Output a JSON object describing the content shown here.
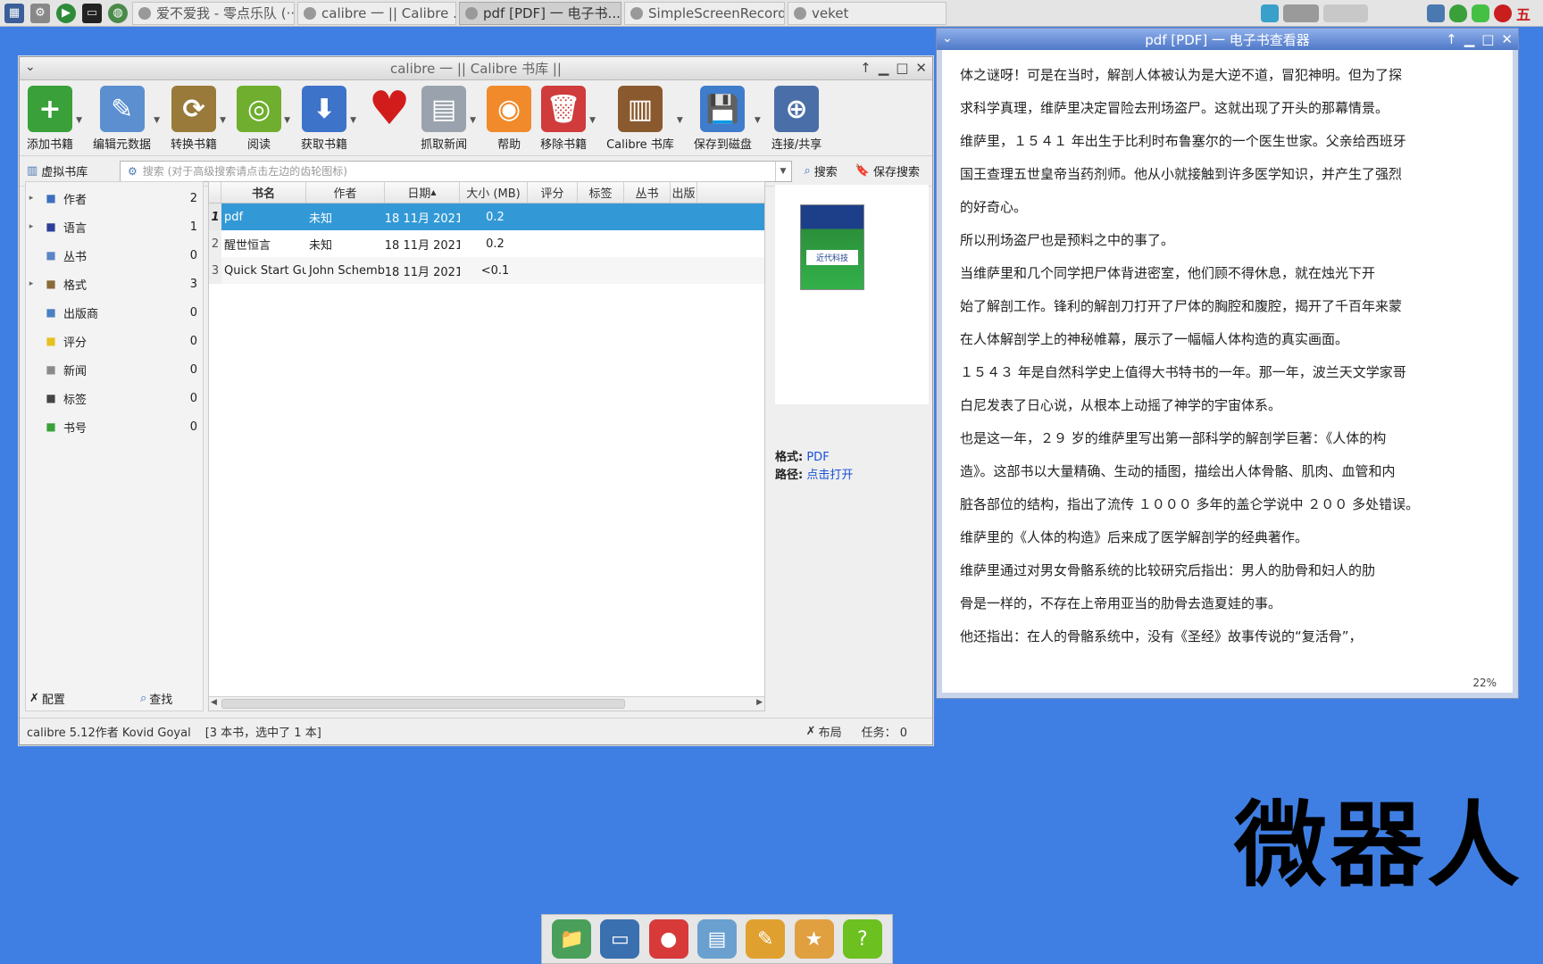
{
  "taskbar": {
    "tasks": [
      {
        "label": "爱不爱我 - 零点乐队 (···",
        "active": false
      },
      {
        "label": "calibre 一 || Calibre ...",
        "active": false
      },
      {
        "label": "pdf [PDF] 一 电子书...",
        "active": true
      },
      {
        "label": "SimpleScreenRecorder",
        "active": false
      },
      {
        "label": "veket",
        "active": false
      }
    ],
    "tray_text": "五"
  },
  "calibre": {
    "title": "calibre 一 || Calibre 书库 ||",
    "toolbar": [
      {
        "label": "添加书籍",
        "icon": "add-book-icon",
        "color": "#3aa03a",
        "glyph": "+"
      },
      {
        "label": "编辑元数据",
        "icon": "edit-metadata-icon",
        "color": "#5b8fd0",
        "glyph": "✎"
      },
      {
        "label": "转换书籍",
        "icon": "convert-book-icon",
        "color": "#9a7a3a",
        "glyph": "⟳"
      },
      {
        "label": "阅读",
        "icon": "read-book-icon",
        "color": "#6fae2e",
        "glyph": "◎"
      },
      {
        "label": "获取书籍",
        "icon": "get-books-icon",
        "color": "#3d73c8",
        "glyph": "⬇"
      },
      {
        "label": "",
        "icon": "heart-icon",
        "color": "#d21c1c",
        "glyph": "♥"
      },
      {
        "label": "抓取新闻",
        "icon": "fetch-news-icon",
        "color": "#9aa3ad",
        "glyph": "▤"
      },
      {
        "label": "帮助",
        "icon": "help-icon",
        "color": "#f08a2a",
        "glyph": "◉"
      },
      {
        "label": "移除书籍",
        "icon": "remove-book-icon",
        "color": "#d03b3b",
        "glyph": "🗑"
      },
      {
        "label": "Calibre 书库",
        "icon": "library-icon",
        "color": "#8a5a2e",
        "glyph": "▥"
      },
      {
        "label": "保存到磁盘",
        "icon": "save-disk-icon",
        "color": "#3f7ccc",
        "glyph": "💾"
      },
      {
        "label": "连接/共享",
        "icon": "connect-share-icon",
        "color": "#4a6fa8",
        "glyph": "⊕"
      }
    ],
    "virtual_library": "虚拟书库",
    "search_placeholder": "搜索 (对于高级搜索请点击左边的齿轮图标)",
    "search_label": "搜索",
    "save_search_label": "保存搜索",
    "tags": [
      {
        "label": "作者",
        "count": "2",
        "expandable": true,
        "icon": "author-icon",
        "color": "#3d6fc0"
      },
      {
        "label": "语言",
        "count": "1",
        "expandable": true,
        "icon": "language-icon",
        "color": "#2d3f9a"
      },
      {
        "label": "丛书",
        "count": "0",
        "expandable": false,
        "icon": "series-icon",
        "color": "#5a86c8"
      },
      {
        "label": "格式",
        "count": "3",
        "expandable": true,
        "icon": "format-icon",
        "color": "#8a6a3a"
      },
      {
        "label": "出版商",
        "count": "0",
        "expandable": false,
        "icon": "publisher-icon",
        "color": "#4a80c4"
      },
      {
        "label": "评分",
        "count": "0",
        "expandable": false,
        "icon": "rating-star-icon",
        "color": "#e8c020"
      },
      {
        "label": "新闻",
        "count": "0",
        "expandable": false,
        "icon": "news-icon",
        "color": "#8a8a8a"
      },
      {
        "label": "标签",
        "count": "0",
        "expandable": false,
        "icon": "tag-icon",
        "color": "#444444"
      },
      {
        "label": "书号",
        "count": "0",
        "expandable": false,
        "icon": "barcode-icon",
        "color": "#3aa03a"
      }
    ],
    "configure_label": "配置",
    "find_label": "查找",
    "columns": [
      "书名",
      "作者",
      "日期",
      "大小 (MB)",
      "评分",
      "标签",
      "丛书",
      "出版"
    ],
    "books": [
      {
        "num": "1",
        "title": "pdf",
        "author": "未知",
        "date": "18 11月 2021",
        "size": "0.2",
        "selected": true
      },
      {
        "num": "2",
        "title": "醒世恒言",
        "author": "未知",
        "date": "18 11月 2021",
        "size": "0.2",
        "selected": false
      },
      {
        "num": "3",
        "title": "Quick Start Guide",
        "author": "John Schember",
        "date": "18 11月 2021",
        "size": "<0.1",
        "selected": false
      }
    ],
    "details": {
      "format_label": "格式:",
      "format_value": "PDF",
      "path_label": "路径:",
      "path_value": "点击打开",
      "cover_title": "近代科技"
    },
    "status": {
      "version": "calibre 5.12作者 Kovid Goyal",
      "books_info": "[3 本书，选中了 1 本]",
      "layout": "布局",
      "jobs": "任务： 0"
    }
  },
  "viewer": {
    "title": "pdf [PDF] 一 电子书查看器",
    "lines": [
      "体之谜呀！可是在当时，解剖人体被认为是大逆不道，冒犯神明。但为了探",
      "求科学真理，维萨里决定冒险去刑场盗尸。这就出现了开头的那幕情景。",
      "维萨里，１５４１ 年出生于比利时布鲁塞尔的一个医生世家。父亲给西班牙",
      "国王查理五世皇帝当药剂师。他从小就接触到许多医学知识，并产生了强烈",
      "的好奇心。",
      "所以刑场盗尸也是预料之中的事了。",
      "当维萨里和几个同学把尸体背进密室，他们顾不得休息，就在烛光下开",
      "始了解剖工作。锋利的解剖刀打开了尸体的胸腔和腹腔，揭开了千百年来蒙",
      "在人体解剖学上的神秘帷幕，展示了一幅幅人体构造的真实画面。",
      "１５４３ 年是自然科学史上值得大书特书的一年。那一年，波兰天文学家哥",
      "白尼发表了日心说，从根本上动摇了神学的宇宙体系。",
      "也是这一年，２９ 岁的维萨里写出第一部科学的解剖学巨著：《人体的构",
      "造》。这部书以大量精确、生动的插图，描绘出人体骨骼、肌肉、血管和内",
      "脏各部位的结构，指出了流传 １０００ 多年的盖仑学说中 ２００ 多处错误。",
      "维萨里的《人体的构造》后来成了医学解剖学的经典著作。",
      "维萨里通过对男女骨骼系统的比较研究后指出：男人的肋骨和妇人的肋",
      "骨是一样的，不存在上帝用亚当的肋骨去造夏娃的事。",
      "他还指出：在人的骨骼系统中，没有《圣经》故事传说的“复活骨”，"
    ],
    "progress": "22%"
  },
  "desktop": {
    "big_text": "微器人",
    "dock": [
      {
        "icon": "folder-icon",
        "color": "#4aa05a"
      },
      {
        "icon": "computer-icon",
        "color": "#3a6fb0"
      },
      {
        "icon": "mascot-icon",
        "color": "#d83a3a"
      },
      {
        "icon": "notepad-icon",
        "color": "#6aa0d0"
      },
      {
        "icon": "paint-icon",
        "color": "#e0a030"
      },
      {
        "icon": "veket-icon",
        "color": "#e0a040"
      },
      {
        "icon": "help-question-icon",
        "color": "#6cc020"
      }
    ]
  }
}
